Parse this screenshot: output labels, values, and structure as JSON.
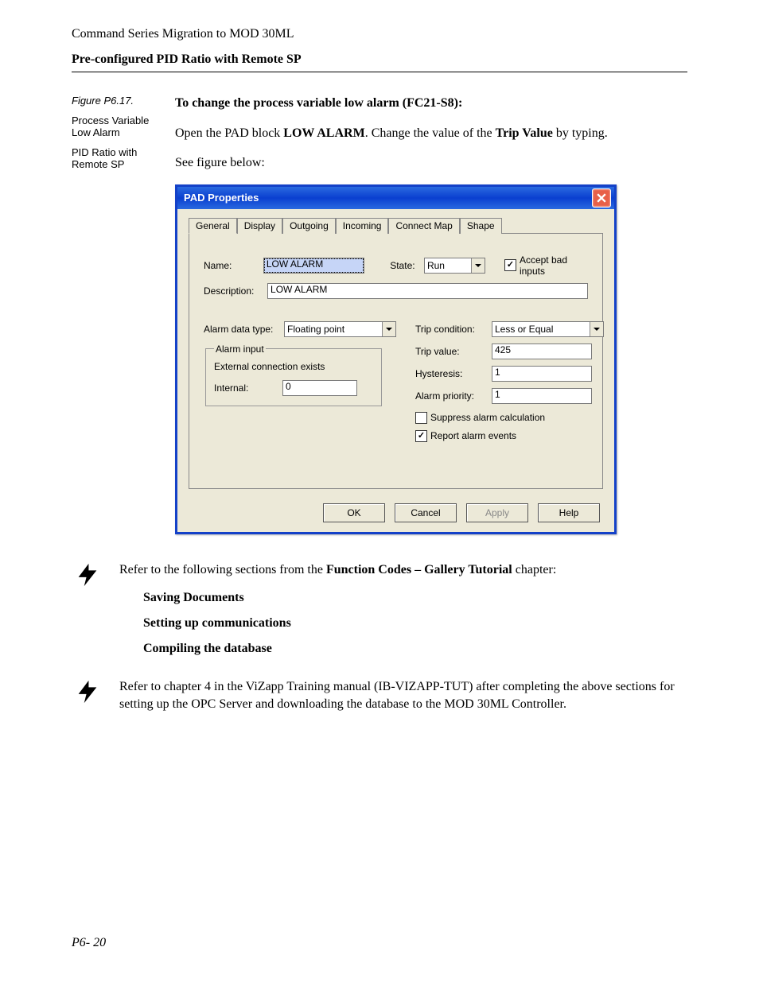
{
  "header": {
    "doc_title": "Command Series Migration to MOD 30ML",
    "section_title": "Pre-configured PID Ratio with Remote SP"
  },
  "intro": {
    "heading": "To change the process variable low alarm (FC21-S8):",
    "line_prefix": "Open the PAD block ",
    "block_name": "LOW ALARM",
    "line_mid": ". Change the value of the ",
    "trip_value_bold": "Trip Value",
    "line_suffix": " by typing.",
    "see_fig": "See figure below:"
  },
  "side": {
    "fig_title": "Figure P6.17.",
    "cap1": "Process Variable Low Alarm",
    "cap2": "PID Ratio with Remote SP"
  },
  "dialog": {
    "title": "PAD Properties",
    "tabs": [
      "General",
      "Display",
      "Outgoing",
      "Incoming",
      "Connect Map",
      "Shape"
    ],
    "labels": {
      "name": "Name:",
      "state": "State:",
      "accept_bad": "Accept bad inputs",
      "description": "Description:",
      "alarm_data_type": "Alarm data type:",
      "alarm_input_legend": "Alarm input",
      "ext_conn": "External connection exists",
      "internal": "Internal:",
      "trip_condition": "Trip condition:",
      "trip_value": "Trip value:",
      "hysteresis": "Hysteresis:",
      "alarm_priority": "Alarm priority:",
      "suppress": "Suppress alarm calculation",
      "report": "Report alarm events"
    },
    "values": {
      "name": "LOW ALARM",
      "state": "Run",
      "accept_bad_checked": true,
      "description": "LOW  ALARM",
      "alarm_data_type": "Floating point",
      "internal": "0",
      "trip_condition": "Less or Equal",
      "trip_value": "425",
      "hysteresis": "1",
      "alarm_priority": "1",
      "suppress_checked": false,
      "report_checked": true
    },
    "buttons": {
      "ok": "OK",
      "cancel": "Cancel",
      "apply": "Apply",
      "help": "Help"
    }
  },
  "note1": {
    "text_prefix": "Refer to the following sections from the ",
    "bold": "Function Codes – Gallery Tutorial",
    "text_suffix": " chapter:",
    "items": [
      "Saving Documents",
      "Setting up communications",
      "Compiling the database"
    ]
  },
  "note2": {
    "text": "Refer to chapter 4 in the ViZapp Training manual (IB-VIZAPP-TUT) after completing the above sections for setting up the OPC Server and downloading the database to the MOD 30ML Controller."
  },
  "page_num": "P6- 20"
}
